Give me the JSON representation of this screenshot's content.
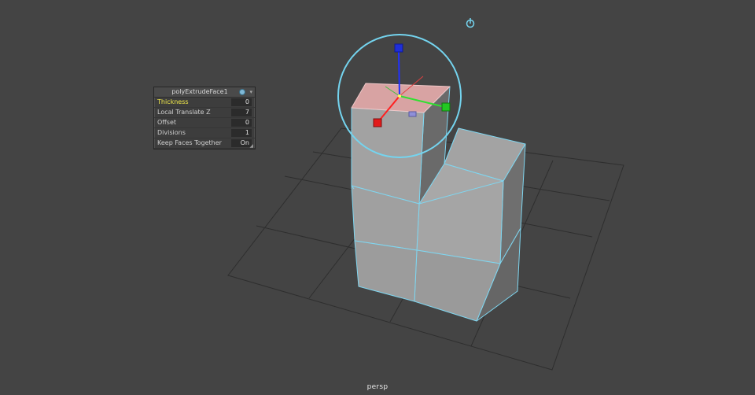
{
  "viewport": {
    "camera_label": "persp",
    "colors": {
      "background": "#444444",
      "grid": "#2e2e2e",
      "mesh_face": "#9e9e9e",
      "mesh_edge": "#7fd6f0",
      "selected_face": "#d8a0a0",
      "manipulator_ring": "#74d4ef"
    },
    "pivot_icon": "pivot-icon"
  },
  "channel_box": {
    "title": "polyExtrudeFace1",
    "rows": [
      {
        "label": "Thickness",
        "value": "0",
        "active": true
      },
      {
        "label": "Local Translate Z",
        "value": "7",
        "active": false
      },
      {
        "label": "Offset",
        "value": "0",
        "active": false
      },
      {
        "label": "Divisions",
        "value": "1",
        "active": false
      },
      {
        "label": "Keep Faces Together",
        "value": "On",
        "active": false
      }
    ]
  }
}
